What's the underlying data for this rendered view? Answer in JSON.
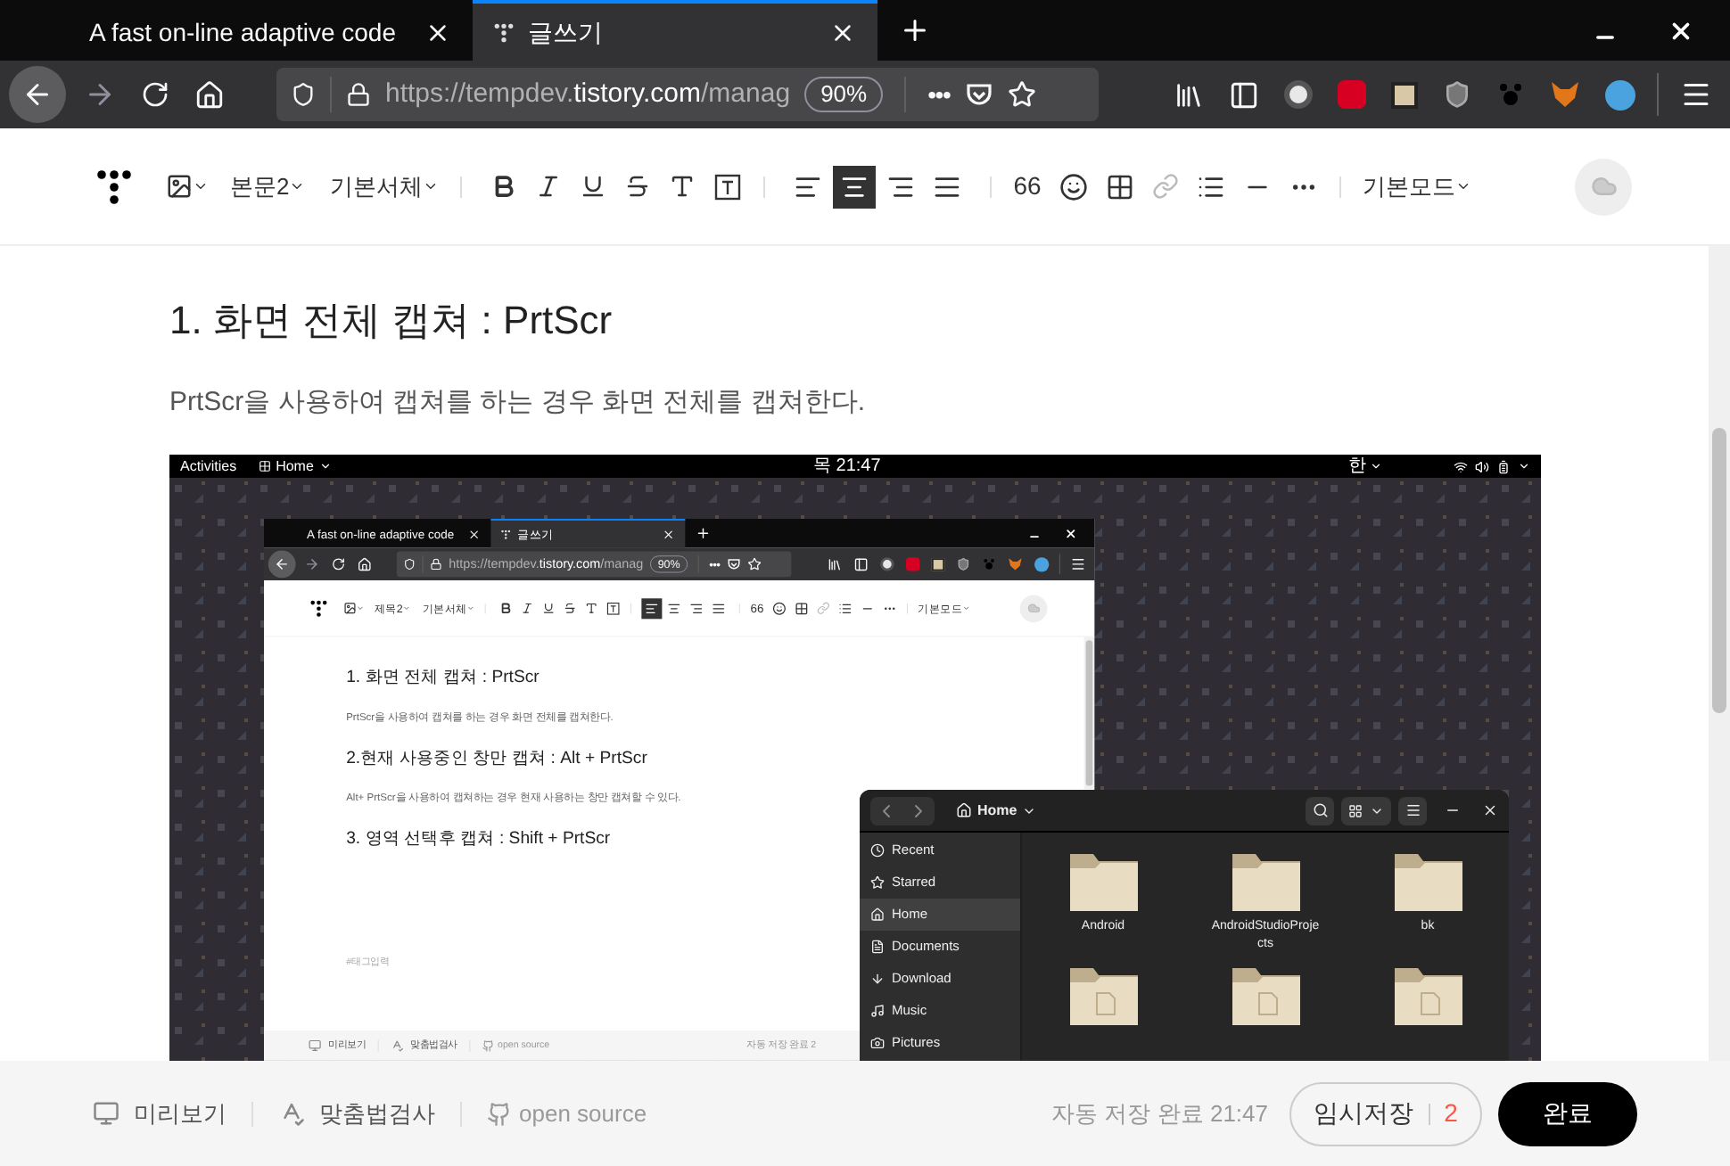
{
  "browser": {
    "tabs": [
      {
        "title": "A fast on-line adaptive code",
        "favicon": false,
        "selected": false
      },
      {
        "title": "글쓰기",
        "favicon": true,
        "selected": true
      }
    ],
    "url": {
      "host": "https://tempdev.",
      "domain": "tistory.com",
      "path": "/manag"
    },
    "zoom": "90%",
    "page_actions": "•••"
  },
  "editor": {
    "toolbar": {
      "paragraph_style": "본문2",
      "font": "기본서체",
      "quote": "66",
      "mode": "기본모드",
      "alignments": [
        {
          "kind": "left",
          "selected": false
        },
        {
          "kind": "center",
          "selected": true
        },
        {
          "kind": "right",
          "selected": false
        },
        {
          "kind": "justify",
          "selected": false
        }
      ]
    },
    "heading": "1. 화면 전체 캡쳐 : PrtScr",
    "paragraph": "PrtScr을 사용하여 캡쳐를 하는 경우 화면 전체를 캡쳐한다.",
    "screenshot": {
      "top_bar": {
        "activities": "Activities",
        "app": "Home",
        "clock": "목 21:47",
        "input_method": "한"
      },
      "browser": {
        "tabs": [
          {
            "title": "A fast on-line adaptive code",
            "favicon": false,
            "selected": false
          },
          {
            "title": "글쓰기",
            "favicon": true,
            "selected": true
          }
        ],
        "url": {
          "host": "https://tempdev.",
          "domain": "tistory.com",
          "path": "/manag"
        },
        "zoom": "90%",
        "page_actions": "•••",
        "toolbar": {
          "paragraph_style": "제목2",
          "font": "기본서체",
          "quote": "66",
          "mode": "기본모드",
          "alignments": [
            {
              "kind": "left",
              "selected": true
            },
            {
              "kind": "center",
              "selected": false
            },
            {
              "kind": "right",
              "selected": false
            },
            {
              "kind": "justify",
              "selected": false
            }
          ]
        },
        "content": [
          {
            "kind": "heading",
            "text": "1. 화면 전체 캡쳐 : PrtScr"
          },
          {
            "kind": "paragraph",
            "text": "PrtScr을 사용하여 캡쳐를 하는 경우 화면 전체를 캡쳐한다."
          },
          {
            "kind": "heading",
            "text": "2.현재 사용중인 창만 캡쳐 : Alt + PrtScr"
          },
          {
            "kind": "paragraph",
            "text": "Alt+ PrtScr을 사용하여 캡쳐하는 경우 현재 사용하는 창만 캡쳐할 수 있다."
          },
          {
            "kind": "heading",
            "text": "3. 영역 선택후 캡쳐 : Shift + PrtScr"
          }
        ],
        "tag_placeholder": "#태그입력",
        "footer": {
          "preview": "미리보기",
          "spellcheck": "맞춤법검사",
          "open_source": "open source",
          "autosave": "자동 저장 완료 2"
        }
      },
      "file_manager": {
        "location": "Home",
        "places": [
          {
            "kind": "recent",
            "label": "Recent",
            "selected": false
          },
          {
            "kind": "starred",
            "label": "Starred",
            "selected": false
          },
          {
            "kind": "home",
            "label": "Home",
            "selected": true
          },
          {
            "kind": "documents",
            "label": "Documents",
            "selected": false
          },
          {
            "kind": "download",
            "label": "Download",
            "selected": false
          },
          {
            "kind": "music",
            "label": "Music",
            "selected": false
          },
          {
            "kind": "pictures",
            "label": "Pictures",
            "selected": false
          }
        ],
        "files": [
          {
            "kind": "folder",
            "name": "Android"
          },
          {
            "kind": "folder",
            "name": "AndroidStudioProjects"
          },
          {
            "kind": "folder",
            "name": "bk"
          },
          {
            "kind": "desktop"
          },
          {
            "kind": "documents"
          },
          {
            "kind": "downloads"
          }
        ]
      }
    }
  },
  "footer": {
    "preview": "미리보기",
    "spellcheck": "맞춤법검사",
    "open_source": "open source",
    "autosave": "자동 저장 완료 21:47",
    "draft": "임시저장",
    "draft_count": "2",
    "publish": "완료"
  }
}
